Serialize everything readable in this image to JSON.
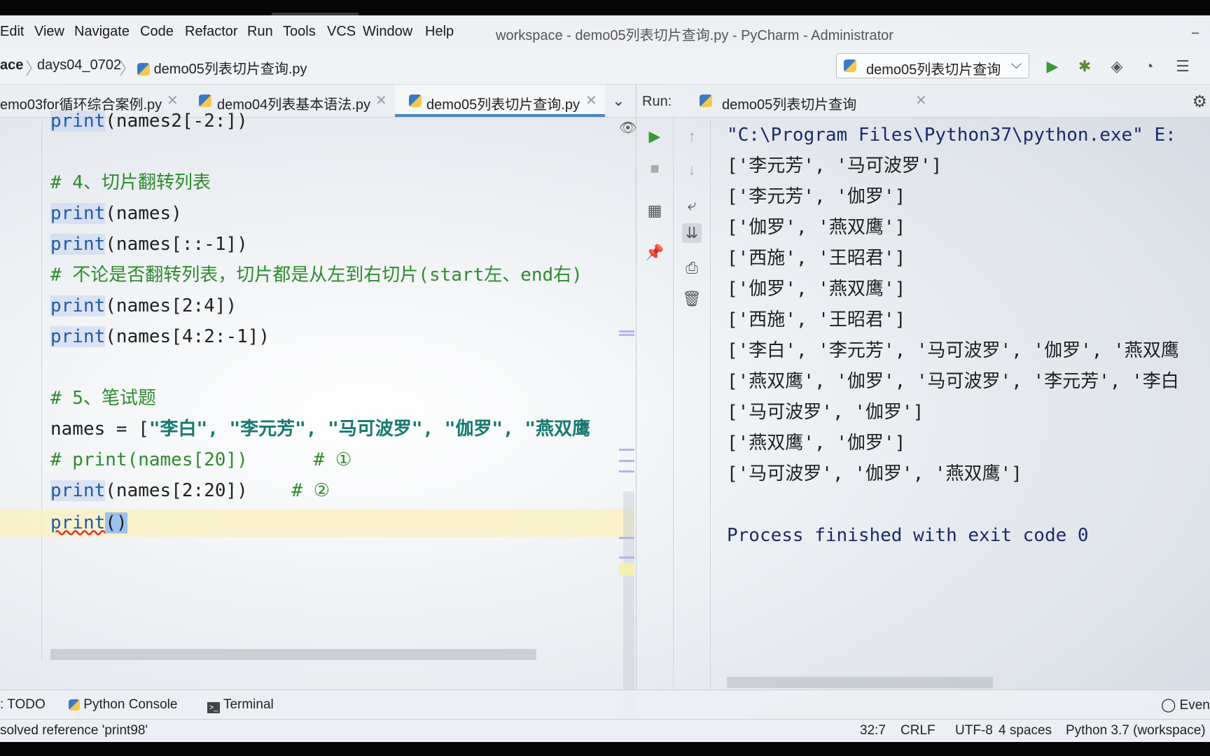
{
  "menu": [
    "Edit",
    "View",
    "Navigate",
    "Code",
    "Refactor",
    "Run",
    "Tools",
    "VCS",
    "Window",
    "Help"
  ],
  "window_title": "workspace - demo05列表切片查询.py - PyCharm - Administrator",
  "window_minimize": "–",
  "breadcrumb": {
    "root": "ace",
    "folder": "days04_0702",
    "file": "demo05列表切片查询.py"
  },
  "run_config": {
    "label": "demo05列表切片查询"
  },
  "editor_tabs": [
    {
      "label": "emo03for循环综合案例.py"
    },
    {
      "label": "demo04列表基本语法.py"
    },
    {
      "label": "demo05列表切片查询.py"
    }
  ],
  "code": {
    "l0_kw": "print",
    "l0_rest": "(names2[-2:])",
    "l2": "# 4、切片翻转列表",
    "l3_kw": "print",
    "l3_rest": "(names)",
    "l4_kw": "print",
    "l4_rest": "(names[::-1])",
    "l5": "# 不论是否翻转列表，切片都是从左到右切片(start左、end右)",
    "l6_kw": "print",
    "l6_rest": "(names[2:4])",
    "l7_kw": "print",
    "l7_rest": "(names[4:2:-1])",
    "l9": "# 5、笔试题",
    "l10_pre": "names = [",
    "l10_strs": "\"李白\", \"李元芳\", \"马可波罗\", \"伽罗\", \"燕双鹰",
    "l11": "# print(names[20])      # ①",
    "l12_kw": "print",
    "l12_rest": "(names[2:20])",
    "l12_cm": "    # ②",
    "l13_kw": "print",
    "l13_paren": "(",
    "l13_paren_close": ")"
  },
  "run": {
    "label": "Run:",
    "tab": "demo05列表切片查询",
    "output": [
      "\"C:\\Program Files\\Python37\\python.exe\" E:",
      "['李元芳', '马可波罗']",
      "['李元芳', '伽罗']",
      "['伽罗', '燕双鹰']",
      "['西施', '王昭君']",
      "['伽罗', '燕双鹰']",
      "['西施', '王昭君']",
      "['李白', '李元芳', '马可波罗', '伽罗', '燕双鹰",
      "['燕双鹰', '伽罗', '马可波罗', '李元芳', '李白",
      "['马可波罗', '伽罗']",
      "['燕双鹰', '伽罗']",
      "['马可波罗', '伽罗', '燕双鹰']",
      "",
      "Process finished with exit code 0"
    ]
  },
  "tool_tabs": {
    "todo": "TODO",
    "console": "Python Console",
    "terminal": "Terminal",
    "event": "Event"
  },
  "status": {
    "message": "solved reference 'print98'",
    "position": "32:7",
    "line_sep": "CRLF",
    "encoding": "UTF-8",
    "indent": "4 spaces",
    "interpreter": "Python 3.7 (workspace)"
  }
}
